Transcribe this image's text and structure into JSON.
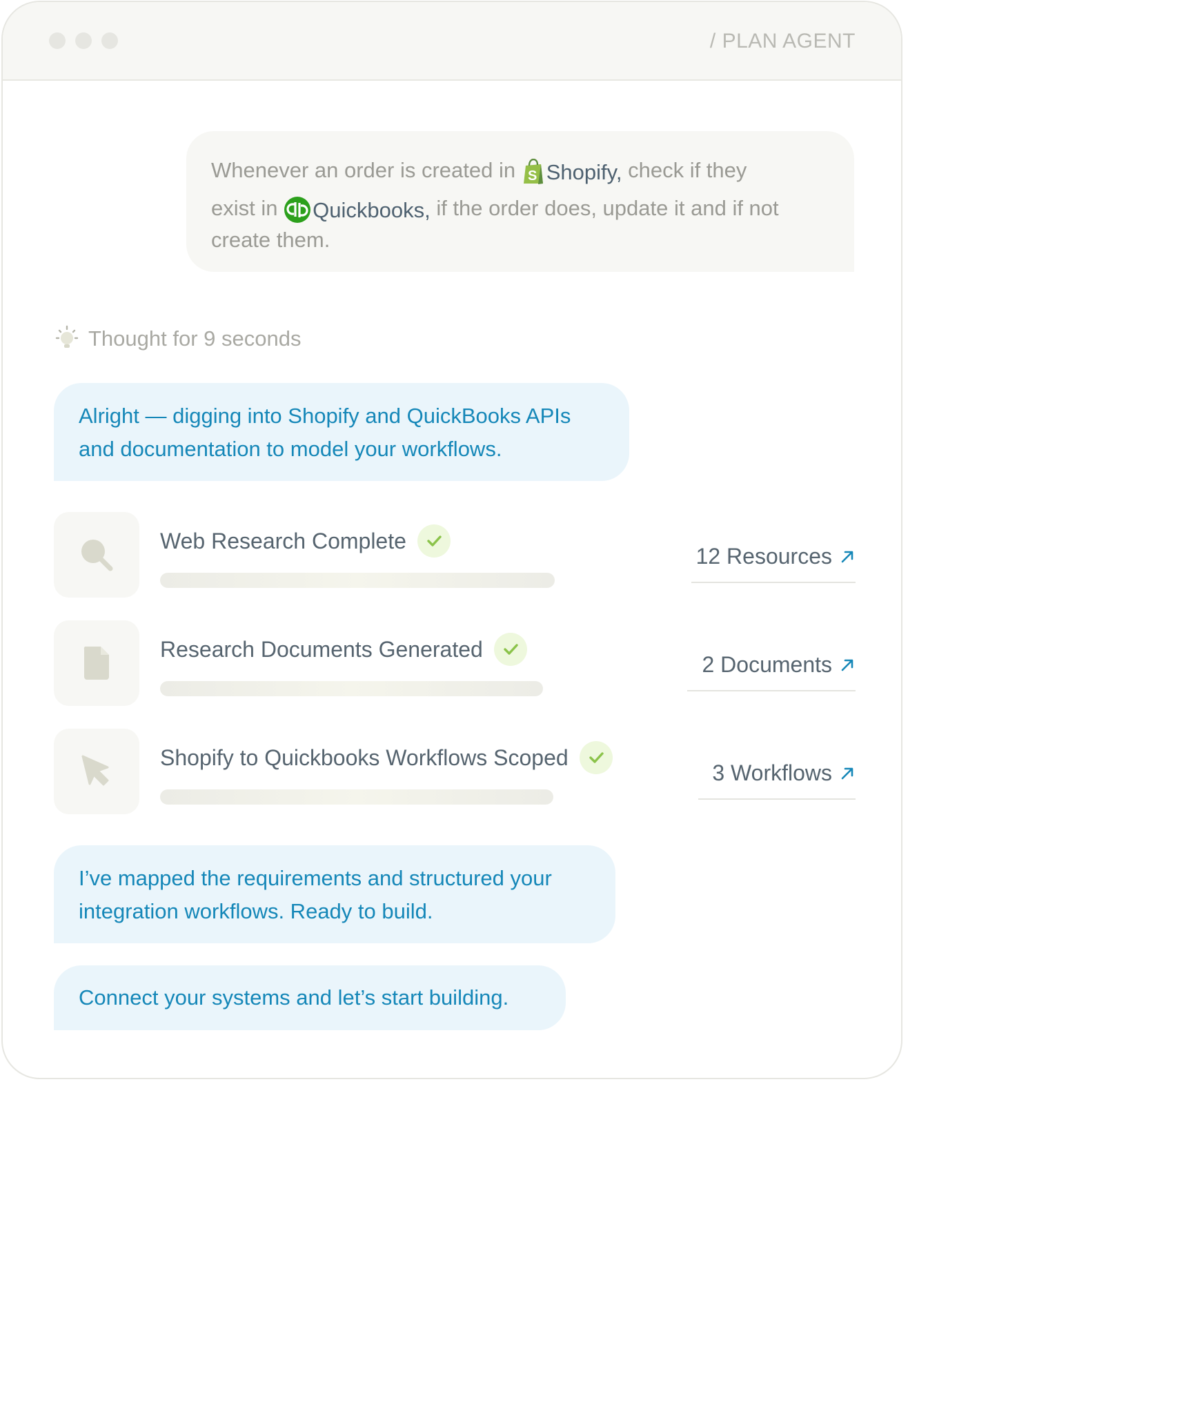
{
  "window": {
    "breadcrumb": "/ PLAN AGENT"
  },
  "user_message": {
    "line1_before": "Whenever an order is created in",
    "brand1": "Shopify,",
    "line1_after": "check if they",
    "line2_before": "exist in",
    "brand2": "Quickbooks,",
    "line2_after": "if the order does, update it and if not",
    "line3": "create them."
  },
  "thought": {
    "label": "Thought for 9 seconds"
  },
  "agent_messages": [
    {
      "text": "Alright — digging into Shopify and QuickBooks APIs and documentation to model your workflows."
    },
    {
      "text": "I’ve mapped the requirements and structured your integration workflows. Ready to build."
    },
    {
      "text": "Connect your systems and let’s start building."
    }
  ],
  "tasks": [
    {
      "title": "Web Research Complete",
      "icon": "search-icon",
      "link": "12 Resources",
      "progress": 1.0
    },
    {
      "title": "Research Documents Generated",
      "icon": "document-icon",
      "link": "2 Documents",
      "progress": 1.0
    },
    {
      "title": "Shopify to Quickbooks Workflows Scoped",
      "icon": "cursor-icon",
      "link": "3 Workflows",
      "progress": 1.0
    }
  ],
  "colors": {
    "accent_text": "#1587b8",
    "agent_bubble_bg": "#eaf5fb",
    "check_green": "#8bc34a",
    "shopify_green": "#95bf47",
    "quickbooks_green": "#2ca01c"
  }
}
